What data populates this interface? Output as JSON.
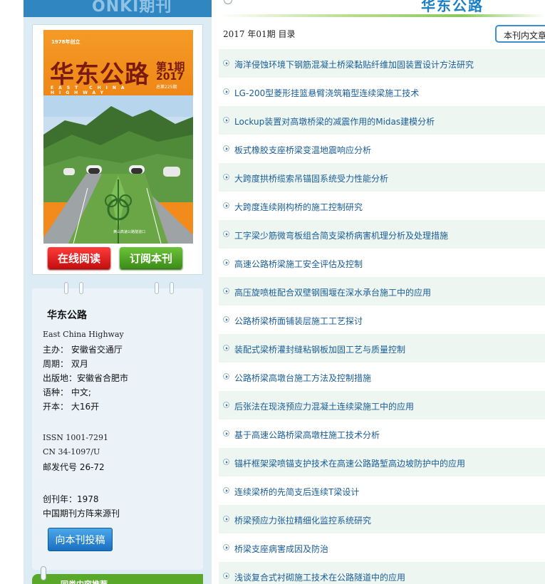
{
  "left_header_ghost": "ONKI期刊",
  "cover": {
    "founded": "1978年创立",
    "title": "华东公路",
    "issue": "第1期",
    "year": "2017",
    "total": "总第225期",
    "english": "EAST CHINA HIGHWAY",
    "caption": "黄山高速公路隧道口"
  },
  "buttons": {
    "read_online": "在线阅读",
    "subscribe": "订阅本刊",
    "submit": "向本刊投稿"
  },
  "info": {
    "title": "华东公路",
    "english_name": "East China Highway",
    "sponsor": "主办： 安徽省交通厅",
    "period": "周期： 双月",
    "location": "出版地：安徽省合肥市",
    "language": "语种： 中文;",
    "format": "开本： 大16开",
    "issn": "ISSN 1001-7291",
    "cn": "CN 34-1097/U",
    "postal": "邮发代号 26-72",
    "founded": "创刊年：1978",
    "source": "中国期刊方阵来源刊"
  },
  "bottom_tab": "同类内容推荐",
  "header": {
    "journal_name": "华东公路",
    "toc_label": "2017 年01期 目录",
    "search_placeholder": "本刊内文章"
  },
  "articles": [
    "海洋侵蚀环境下钢筋混凝土桥梁黏贴纤维加固装置设计方法研究",
    "LG-200型菱形挂篮悬臂浇筑箱型连续梁施工技术",
    "Lockup装置对高墩桥梁的减震作用的Midas建模分析",
    "板式橡胶支座桥梁变温地震响应分析",
    "大跨度拱桥缆索吊锚固系统受力性能分析",
    "大跨度连续刚构桥的施工控制研究",
    "工字梁少筋微弯板组合简支梁桥病害机理分析及处理措施",
    "高速公路桥梁施工安全评估及控制",
    "高压旋喷桩配合双壁钢围堰在深水承台施工中的应用",
    "公路桥梁桥面铺装层施工工艺探讨",
    "装配式梁桥灌封缝粘钢板加固工艺与质量控制",
    "公路桥梁高墩台施工方法及控制措施",
    "后张法在现浇预应力混凝土连续梁施工中的应用",
    "基于高速公路桥梁高墩柱施工技术分析",
    "锚杆框架梁喷锚支护技术在高速公路路堑高边坡防护中的应用",
    "连续梁桥的先简支后连续T梁设计",
    "桥梁预应力张拉精细化监控系统研究",
    "桥梁支座病害成因及防治",
    "浅谈复合式衬砌施工技术在公路隧道中的应用"
  ]
}
